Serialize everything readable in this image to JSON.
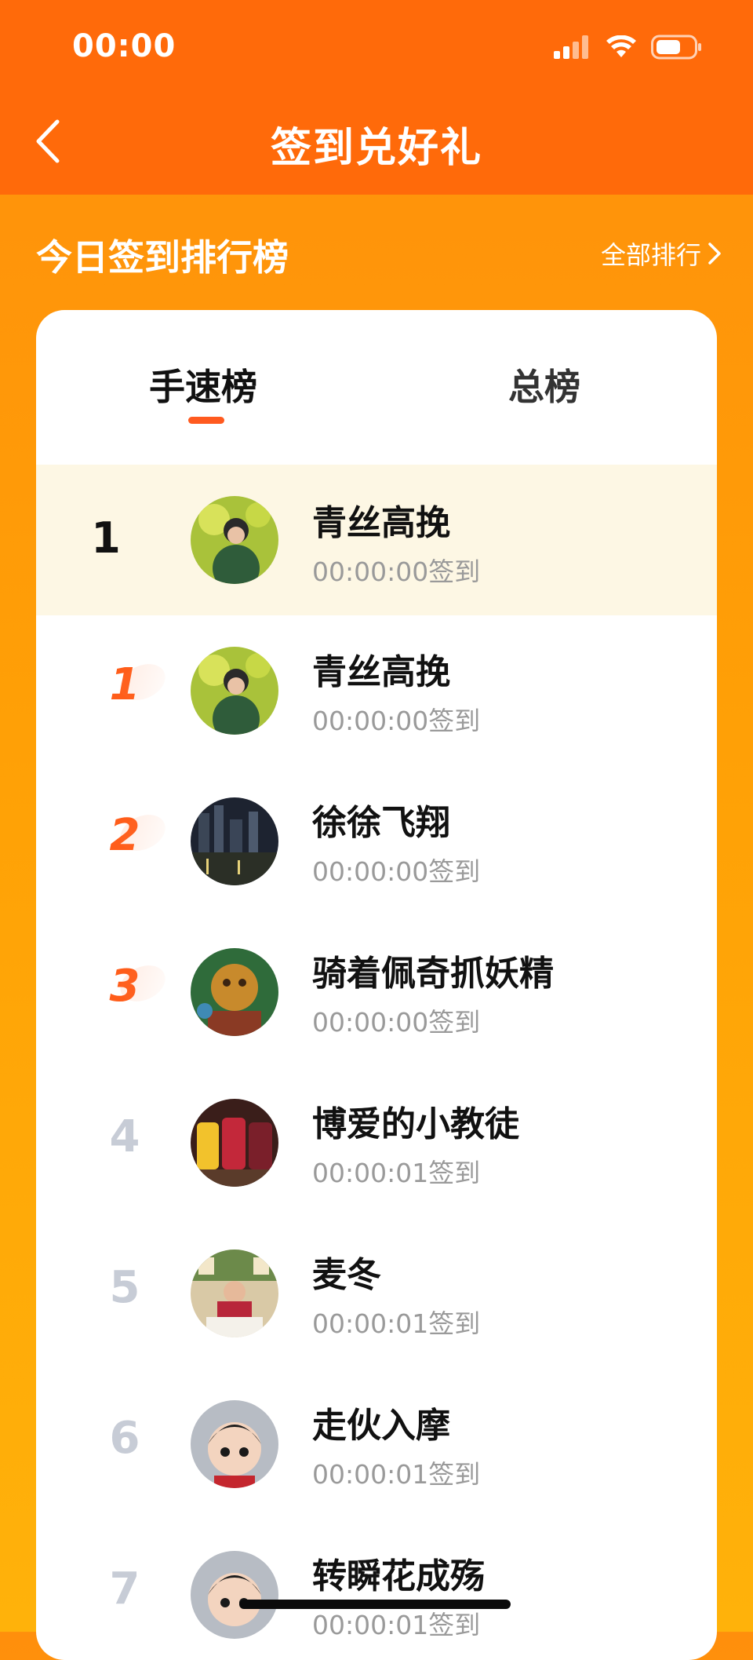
{
  "status_bar": {
    "time": "00:00",
    "signal_icon": "signal-icon",
    "wifi_icon": "wifi-icon",
    "battery_icon": "battery-icon"
  },
  "header": {
    "title": "签到兑好礼",
    "back_icon": "chevron-left-icon"
  },
  "section": {
    "title": "今日签到排行榜",
    "link_label": "全部排行",
    "link_icon": "chevron-right-icon"
  },
  "tabs": [
    {
      "label": "手速榜",
      "active": true
    },
    {
      "label": "总榜",
      "active": false
    }
  ],
  "my_row": {
    "rank": "1",
    "name": "青丝高挽",
    "time": "00:00:00签到"
  },
  "rows": [
    {
      "rank": "1",
      "name": "青丝高挽",
      "time": "00:00:00签到"
    },
    {
      "rank": "2",
      "name": "徐徐飞翔",
      "time": "00:00:00签到"
    },
    {
      "rank": "3",
      "name": "骑着佩奇抓妖精",
      "time": "00:00:00签到"
    },
    {
      "rank": "4",
      "name": "博爱的小教徒",
      "time": "00:00:01签到"
    },
    {
      "rank": "5",
      "name": "麦冬",
      "time": "00:00:01签到"
    },
    {
      "rank": "6",
      "name": "走伙入摩",
      "time": "00:00:01签到"
    },
    {
      "rank": "7",
      "name": "转瞬花成殇",
      "time": "00:00:01签到"
    }
  ],
  "colors": {
    "header_bg": "#ff6a0a",
    "accent": "#ff5a1f",
    "my_row_bg": "#fdf7e4"
  }
}
